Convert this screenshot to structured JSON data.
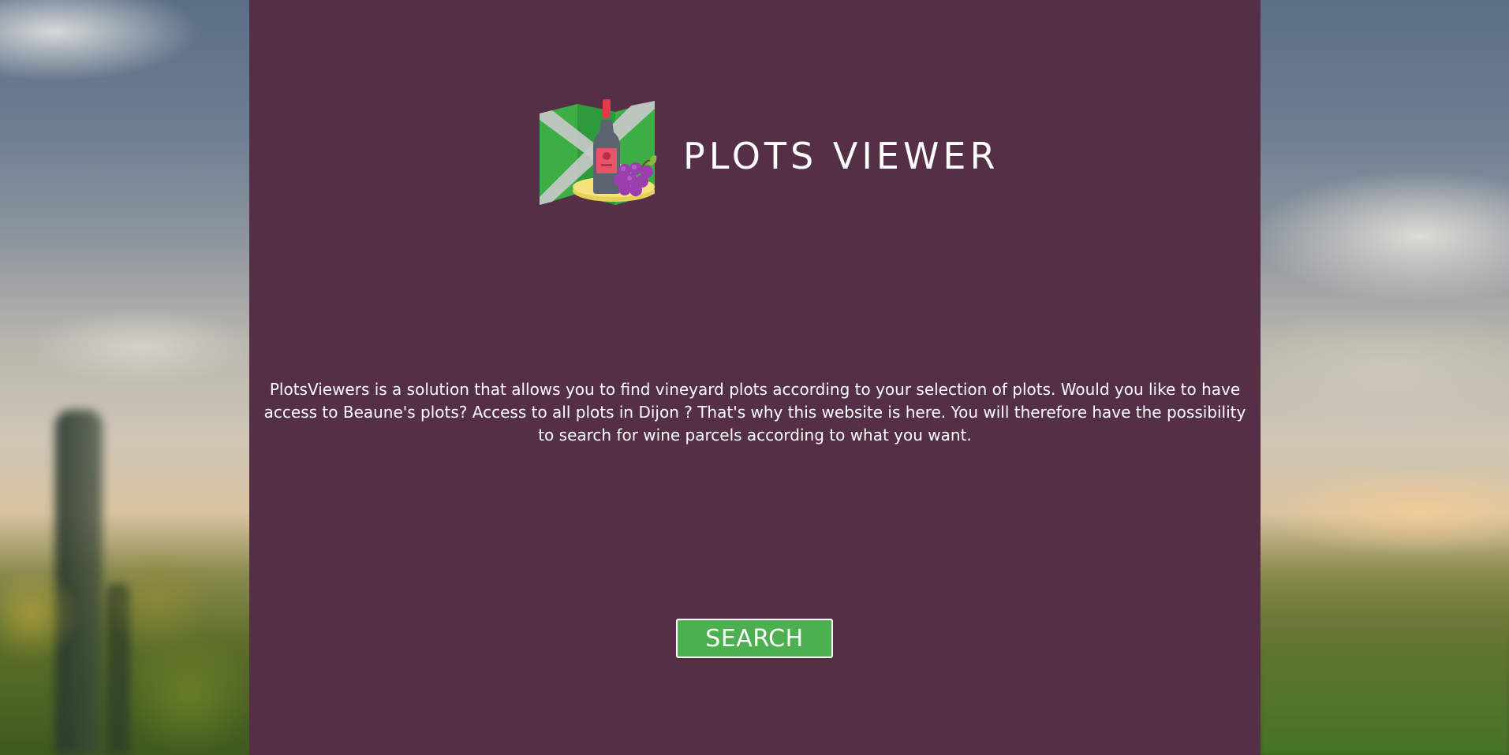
{
  "app": {
    "title": "PLOTS VIEWER",
    "logo_icon": "vineyard-map-wine-grapes-icon"
  },
  "main": {
    "description": "PlotsViewers is a solution that allows you to find vineyard plots according to your selection of plots. Would you like to have access to Beaune's plots? Access to all plots in Dijon ? That's why this website is here. You will therefore have the possibility to search for wine parcels according to what you want.",
    "search_label": "SEARCH"
  },
  "colors": {
    "panel": "#552f46",
    "button": "#4caf50",
    "text": "#ffffff"
  }
}
